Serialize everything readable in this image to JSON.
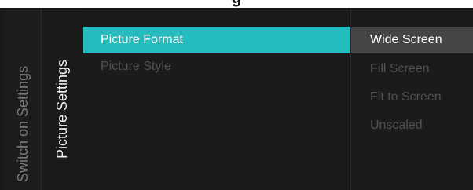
{
  "header": {
    "title_fragment": "g"
  },
  "breadcrumbs": {
    "parent": "Switch on Settings",
    "current": "Picture Settings"
  },
  "menu": {
    "items": [
      {
        "label": "Picture Format",
        "selected": true
      },
      {
        "label": "Picture Style",
        "selected": false
      }
    ]
  },
  "options": {
    "items": [
      {
        "label": "Wide Screen",
        "selected": true
      },
      {
        "label": "Fill Screen",
        "selected": false
      },
      {
        "label": "Fit to Screen",
        "selected": false
      },
      {
        "label": "Unscaled",
        "selected": false
      }
    ]
  },
  "colors": {
    "highlight": "#25bcbd",
    "option_highlight": "#454545",
    "background": "#1b1b1b",
    "dim_text": "#505050"
  }
}
